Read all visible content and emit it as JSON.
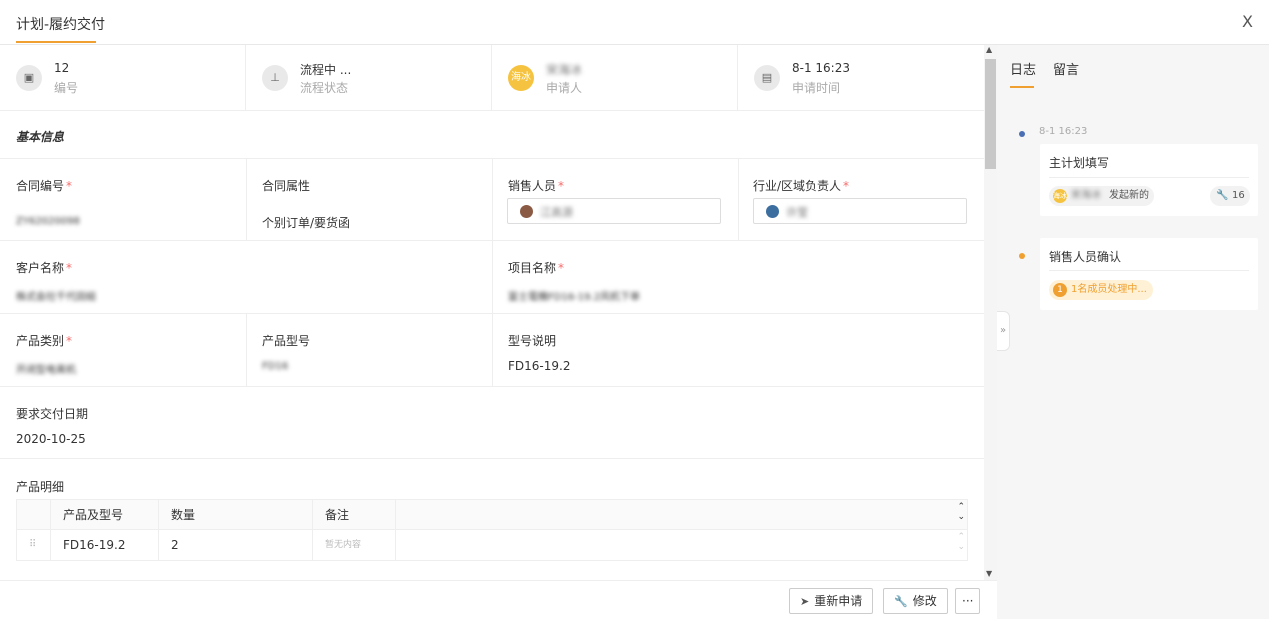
{
  "window": {
    "title": "计划-履约交付",
    "close_label": "X"
  },
  "summary": [
    {
      "icon": "document-icon",
      "glyph": "▣",
      "value": "12",
      "label": "编号"
    },
    {
      "icon": "flow-icon",
      "glyph": "⊥",
      "value": "流程中 ...",
      "label": "流程状态"
    },
    {
      "icon": "avatar-icon",
      "glyph": "海冰",
      "value": "宋海冰",
      "label": "申请人"
    },
    {
      "icon": "calendar-icon",
      "glyph": "▤",
      "value": "8-1 16:23",
      "label": "申请时间"
    }
  ],
  "section_title": "基本信息",
  "form": {
    "contract_no": {
      "label": "合同编号",
      "value": "ZY62020098"
    },
    "contract_attr": {
      "label": "合同属性",
      "value": "个别订单/要货函"
    },
    "sales_person": {
      "label": "销售人员",
      "value": "江高源"
    },
    "region_owner": {
      "label": "行业/区域负责人",
      "value": "许莹"
    },
    "customer_name": {
      "label": "客户名称",
      "value": "株式会社千代田組"
    },
    "project_name": {
      "label": "项目名称",
      "value": "富士電機FD16-19.2风机下单"
    },
    "product_category": {
      "label": "产品类别",
      "value": "开闭型电离机"
    },
    "product_model": {
      "label": "产品型号",
      "value": "FD16"
    },
    "model_desc": {
      "label": "型号说明",
      "value": "FD16-19.2"
    },
    "delivery_date": {
      "label": "要求交付日期",
      "value": "2020-10-25"
    },
    "required_mark": "*"
  },
  "detail": {
    "title": "产品明细",
    "headers": [
      "产品及型号",
      "数量",
      "备注"
    ],
    "rows": [
      {
        "model": "FD16-19.2",
        "qty": "2",
        "note": "暂无内容"
      }
    ]
  },
  "actions": {
    "reapply": "重新申请",
    "modify": "修改",
    "more": "···"
  },
  "side": {
    "tabs": [
      "日志",
      "留言"
    ],
    "timeline": [
      {
        "time": "8-1 16:23",
        "title": "主计划填写",
        "user": "宋海冰",
        "user_short": "海冰",
        "action": "发起新的",
        "badge": "16"
      },
      {
        "title": "销售人员确认",
        "count": "1",
        "status": "1名成员处理中..."
      }
    ]
  },
  "colors": {
    "accent": "#f0a030",
    "avatar": "#f5c340",
    "required": "#f56c6c",
    "timeline_blue": "#4a6fb5"
  }
}
